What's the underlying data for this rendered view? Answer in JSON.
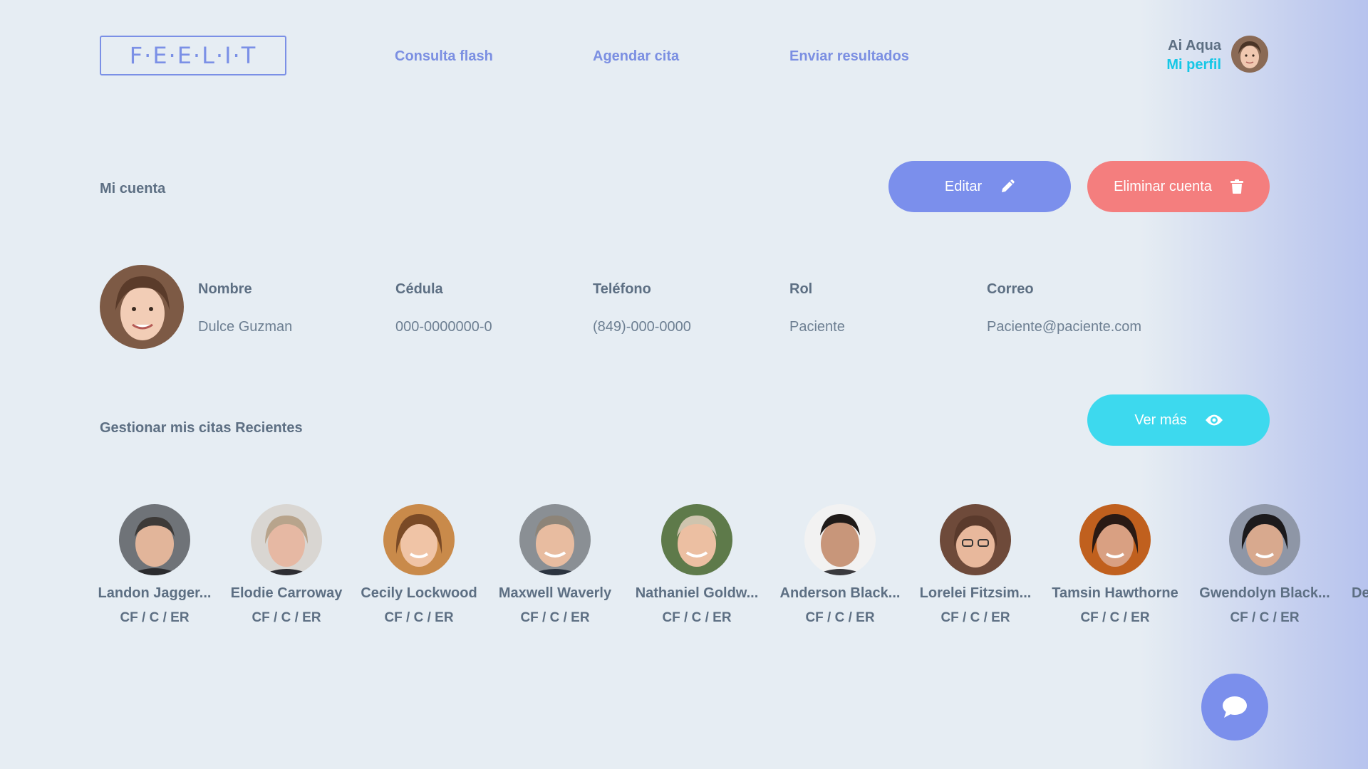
{
  "header": {
    "logo_text": "F·E·E·L·I·T",
    "nav": [
      {
        "label": "Consulta flash"
      },
      {
        "label": "Agendar cita"
      },
      {
        "label": "Enviar resultados"
      }
    ],
    "user": {
      "name": "Ai Aqua",
      "profile_link": "Mi perfil"
    }
  },
  "account": {
    "title": "Mi cuenta",
    "edit_label": "Editar",
    "delete_label": "Eliminar cuenta",
    "fields": [
      {
        "label": "Nombre",
        "value": "Dulce Guzman"
      },
      {
        "label": "Cédula",
        "value": "000-0000000-0"
      },
      {
        "label": "Teléfono",
        "value": "(849)-000-0000"
      },
      {
        "label": "Rol",
        "value": "Paciente"
      },
      {
        "label": "Correo",
        "value": "Paciente@paciente.com"
      }
    ]
  },
  "appointments": {
    "title": "Gestionar mis citas Recientes",
    "more_label": "Ver más",
    "items": [
      {
        "name": "Landon Jagger...",
        "code": "CF / C / ER"
      },
      {
        "name": "Elodie Carroway",
        "code": "CF / C / ER"
      },
      {
        "name": "Cecily Lockwood",
        "code": "CF / C / ER"
      },
      {
        "name": "Maxwell Waverly",
        "code": "CF / C / ER"
      },
      {
        "name": "Nathaniel Goldw...",
        "code": "CF / C / ER"
      },
      {
        "name": "Anderson Black...",
        "code": "CF / C / ER"
      },
      {
        "name": "Lorelei Fitzsim...",
        "code": "CF / C / ER"
      },
      {
        "name": "Tamsin Hawthorne",
        "code": "CF / C / ER"
      },
      {
        "name": "Gwendolyn Black...",
        "code": "CF / C / ER"
      },
      {
        "name": "De",
        "code": ""
      }
    ]
  },
  "icons": {
    "edit": "pencil-icon",
    "delete": "trash-icon",
    "more": "eye-icon",
    "chat": "chat-bubble-icon"
  },
  "colors": {
    "background": "#e6edf3",
    "accent_blue": "#7b8fec",
    "danger": "#f47e7e",
    "cyan": "#3dd9ee",
    "profile_link": "#16c7e6"
  }
}
